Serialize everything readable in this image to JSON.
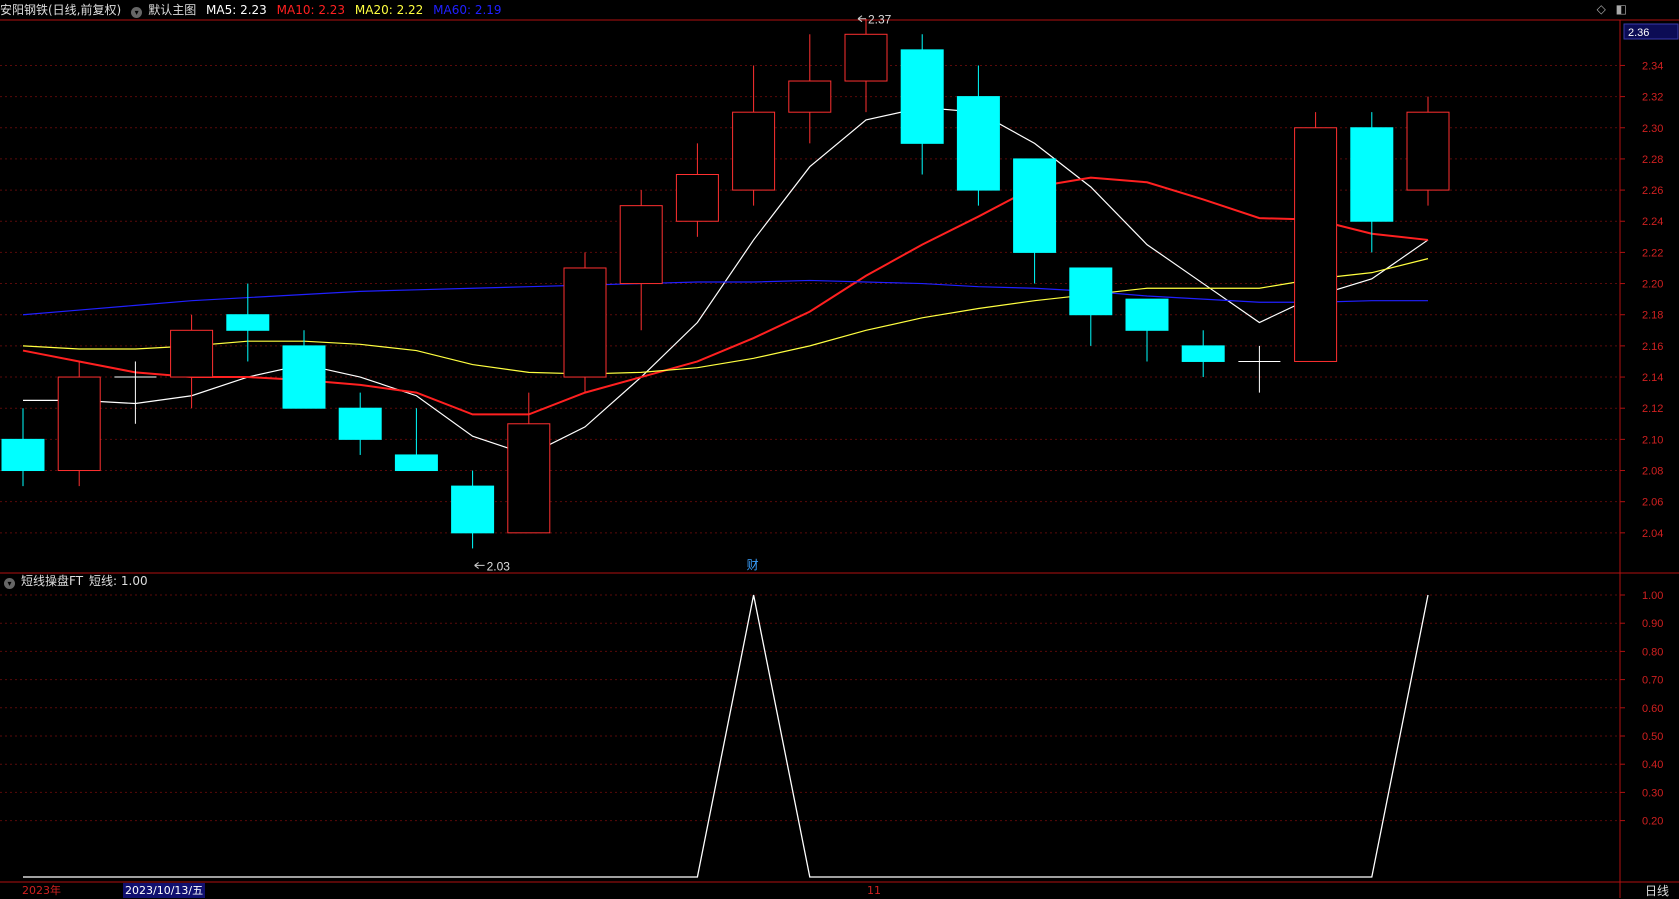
{
  "header": {
    "stock": "安阳钢铁(日线,前复权)",
    "template": "默认主图",
    "ma5": "MA5: 2.23",
    "ma10": "MA10: 2.23",
    "ma20": "MA20: 2.22",
    "ma60": "MA60: 2.19",
    "ma5_color": "#ffffff",
    "ma10_color": "#ff2020",
    "ma20_color": "#ffff40",
    "ma60_color": "#2020ff"
  },
  "sub_header": {
    "indicator": "短线操盘FT",
    "value": "短线: 1.00"
  },
  "top_icons": {
    "diamond": "◇",
    "window": "◧"
  },
  "price_axis": {
    "current_box": "2.36",
    "ticks": [
      "2.34",
      "2.32",
      "2.30",
      "2.28",
      "2.26",
      "2.24",
      "2.22",
      "2.20",
      "2.18",
      "2.16",
      "2.14",
      "2.12",
      "2.10",
      "2.08",
      "2.06",
      "2.04"
    ]
  },
  "sub_axis": {
    "ticks": [
      "1.00",
      "0.90",
      "0.80",
      "0.70",
      "0.60",
      "0.50",
      "0.40",
      "0.30",
      "0.20"
    ]
  },
  "markers": {
    "high": "2.37",
    "low": "2.03",
    "fin": "财"
  },
  "date_bar": {
    "year": "2023年",
    "cursor_date": "2023/10/13/五",
    "month": "11",
    "period": "日线"
  },
  "chart_data": [
    {
      "type": "candlestick",
      "title": "安阳钢铁(日线,前复权)",
      "ylim": [
        2.02,
        2.37
      ],
      "grid": true,
      "candles": [
        {
          "o": 2.1,
          "h": 2.12,
          "l": 2.07,
          "c": 2.08
        },
        {
          "o": 2.08,
          "h": 2.15,
          "l": 2.07,
          "c": 2.14
        },
        {
          "o": 2.14,
          "h": 2.15,
          "l": 2.11,
          "c": 2.14
        },
        {
          "o": 2.14,
          "h": 2.18,
          "l": 2.12,
          "c": 2.17
        },
        {
          "o": 2.18,
          "h": 2.2,
          "l": 2.15,
          "c": 2.17
        },
        {
          "o": 2.16,
          "h": 2.17,
          "l": 2.12,
          "c": 2.12
        },
        {
          "o": 2.12,
          "h": 2.13,
          "l": 2.09,
          "c": 2.1
        },
        {
          "o": 2.09,
          "h": 2.12,
          "l": 2.08,
          "c": 2.08
        },
        {
          "o": 2.07,
          "h": 2.08,
          "l": 2.03,
          "c": 2.04
        },
        {
          "o": 2.04,
          "h": 2.13,
          "l": 2.04,
          "c": 2.11
        },
        {
          "o": 2.14,
          "h": 2.22,
          "l": 2.13,
          "c": 2.21
        },
        {
          "o": 2.2,
          "h": 2.26,
          "l": 2.17,
          "c": 2.25
        },
        {
          "o": 2.24,
          "h": 2.29,
          "l": 2.23,
          "c": 2.27
        },
        {
          "o": 2.26,
          "h": 2.34,
          "l": 2.25,
          "c": 2.31
        },
        {
          "o": 2.31,
          "h": 2.36,
          "l": 2.29,
          "c": 2.33
        },
        {
          "o": 2.33,
          "h": 2.37,
          "l": 2.31,
          "c": 2.36
        },
        {
          "o": 2.35,
          "h": 2.36,
          "l": 2.27,
          "c": 2.29
        },
        {
          "o": 2.32,
          "h": 2.34,
          "l": 2.25,
          "c": 2.26
        },
        {
          "o": 2.28,
          "h": 2.28,
          "l": 2.2,
          "c": 2.22
        },
        {
          "o": 2.21,
          "h": 2.21,
          "l": 2.16,
          "c": 2.18
        },
        {
          "o": 2.19,
          "h": 2.19,
          "l": 2.15,
          "c": 2.17
        },
        {
          "o": 2.16,
          "h": 2.17,
          "l": 2.14,
          "c": 2.15
        },
        {
          "o": 2.15,
          "h": 2.16,
          "l": 2.13,
          "c": 2.15
        },
        {
          "o": 2.15,
          "h": 2.31,
          "l": 2.15,
          "c": 2.3
        },
        {
          "o": 2.3,
          "h": 2.31,
          "l": 2.22,
          "c": 2.24
        },
        {
          "o": 2.26,
          "h": 2.32,
          "l": 2.25,
          "c": 2.31
        }
      ],
      "series": [
        {
          "name": "MA5",
          "color": "#ffffff",
          "values": [
            2.125,
            2.125,
            2.123,
            2.128,
            2.14,
            2.148,
            2.14,
            2.128,
            2.102,
            2.09,
            2.108,
            2.14,
            2.175,
            2.228,
            2.275,
            2.305,
            2.313,
            2.31,
            2.29,
            2.262,
            2.225,
            2.2,
            2.175,
            2.192,
            2.203,
            2.228
          ]
        },
        {
          "name": "MA10",
          "color": "#ff2020",
          "values": [
            2.157,
            2.15,
            2.143,
            2.14,
            2.14,
            2.138,
            2.135,
            2.13,
            2.116,
            2.116,
            2.13,
            2.14,
            2.15,
            2.165,
            2.182,
            2.205,
            2.225,
            2.243,
            2.262,
            2.268,
            2.265,
            2.254,
            2.242,
            2.241,
            2.232,
            2.228
          ]
        },
        {
          "name": "MA20",
          "color": "#ffff40",
          "values": [
            2.16,
            2.158,
            2.158,
            2.16,
            2.163,
            2.163,
            2.161,
            2.157,
            2.148,
            2.143,
            2.142,
            2.143,
            2.146,
            2.152,
            2.16,
            2.17,
            2.178,
            2.184,
            2.189,
            2.193,
            2.197,
            2.197,
            2.197,
            2.203,
            2.207,
            2.216
          ]
        },
        {
          "name": "MA60",
          "color": "#2020ff",
          "values": [
            2.18,
            2.183,
            2.186,
            2.189,
            2.191,
            2.193,
            2.195,
            2.196,
            2.197,
            2.198,
            2.199,
            2.2,
            2.201,
            2.201,
            2.202,
            2.201,
            2.2,
            2.198,
            2.197,
            2.195,
            2.192,
            2.19,
            2.188,
            2.188,
            2.189,
            2.189
          ]
        }
      ]
    },
    {
      "type": "line",
      "title": "短线操盘FT",
      "ylim": [
        0.0,
        1.0
      ],
      "series": [
        {
          "name": "短线",
          "color": "#ffffff",
          "values": [
            0,
            0,
            0,
            0,
            0,
            0,
            0,
            0,
            0,
            0,
            0,
            0,
            0,
            1,
            0,
            0,
            0,
            0,
            0,
            0,
            0,
            0,
            0,
            0,
            0,
            1
          ]
        }
      ]
    }
  ]
}
